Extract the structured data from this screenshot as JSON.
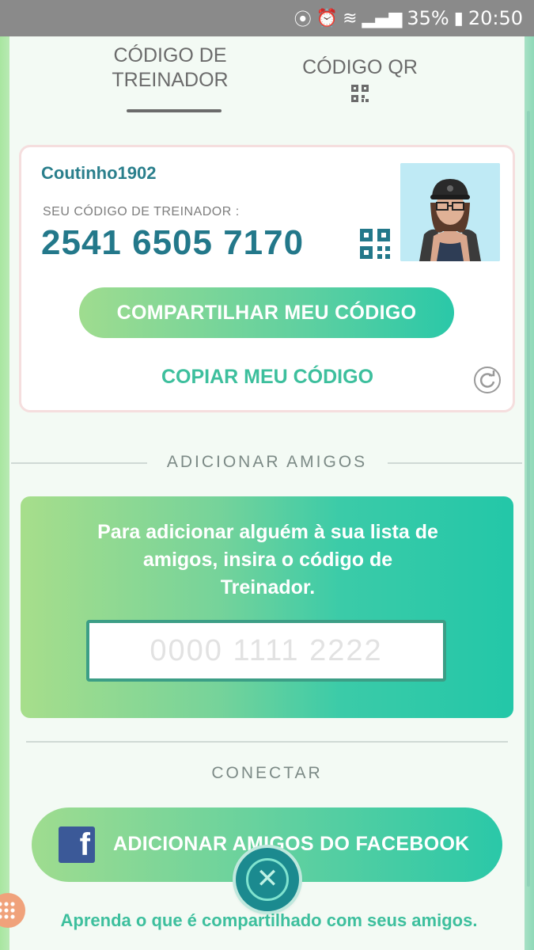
{
  "status_bar": {
    "battery": "35%",
    "time": "20:50",
    "icons": [
      "location-icon",
      "alarm-icon",
      "wifi-icon",
      "signal-icon",
      "battery-icon"
    ]
  },
  "tabs": {
    "trainer_code": "CÓDIGO DE TREINADOR",
    "qr_code": "CÓDIGO QR"
  },
  "trainer": {
    "name": "Coutinho1902",
    "code_label": "SEU CÓDIGO DE TREINADOR :",
    "code": "2541 6505 7170"
  },
  "actions": {
    "share_code": "COMPARTILHAR MEU CÓDIGO",
    "copy_code": "COPIAR MEU CÓDIGO"
  },
  "add_friends": {
    "section_title": "ADICIONAR AMIGOS",
    "instruction": "Para adicionar alguém à sua lista de amigos, insira o código de Treinador.",
    "input_placeholder": "0000 1111 2222",
    "input_value": ""
  },
  "connect": {
    "section_title": "CONECTAR",
    "facebook_button": "ADICIONAR AMIGOS DO FACEBOOK",
    "facebook_icon_letter": "f",
    "learn_link": "Aprenda o que é compartilhado com seus amigos."
  },
  "close_button_symbol": "✕",
  "colors": {
    "accent_teal": "#23788a",
    "accent_green": "#3dbf9d",
    "gradient_start": "#a7de8b",
    "gradient_end": "#23c7a8",
    "facebook_blue": "#3b5998"
  }
}
